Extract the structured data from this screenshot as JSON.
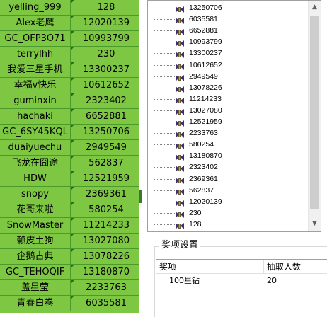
{
  "sheet": {
    "rows": [
      {
        "name": "yelling_999",
        "value": "128"
      },
      {
        "name": "Alex老鹰",
        "value": "12020139"
      },
      {
        "name": "GC_OFP3O71",
        "value": "10993799"
      },
      {
        "name": "terrylhh",
        "value": "230"
      },
      {
        "name": "我爱三星手机",
        "value": "13300237"
      },
      {
        "name": "幸福v快乐",
        "value": "10612652"
      },
      {
        "name": "guminxin",
        "value": "2323402"
      },
      {
        "name": "hachaki",
        "value": "6652881"
      },
      {
        "name": "GC_6SY45KQL",
        "value": "13250706"
      },
      {
        "name": "duaiyuechu",
        "value": "2949549"
      },
      {
        "name": "飞龙在囧途",
        "value": "562837"
      },
      {
        "name": "HDW",
        "value": "12521959"
      },
      {
        "name": "snopy",
        "value": "2369361"
      },
      {
        "name": "花哥来啦",
        "value": "580254"
      },
      {
        "name": "SnowMaster",
        "value": "11214233"
      },
      {
        "name": "赖皮土狗",
        "value": "13027080"
      },
      {
        "name": "企鹅古典",
        "value": "13078226"
      },
      {
        "name": "GC_TEHOQIF",
        "value": "13180870"
      },
      {
        "name": "盖星莹",
        "value": "2233763"
      },
      {
        "name": "青春白卷",
        "value": "6035581"
      }
    ]
  },
  "tree": {
    "items": [
      "13250706",
      "6035581",
      "6652881",
      "10993799",
      "13300237",
      "10612652",
      "2949549",
      "13078226",
      "11214233",
      "13027080",
      "12521959",
      "2233763",
      "580254",
      "13180870",
      "2323402",
      "2369361",
      "562837",
      "12020139",
      "230",
      "128"
    ],
    "scroll_up": "▲",
    "scroll_down": "▼"
  },
  "prize": {
    "group_title": "奖项设置",
    "columns": [
      "奖项",
      "抽取人数"
    ],
    "rows": [
      {
        "prize": "100星钻",
        "count": "20"
      }
    ]
  },
  "colors": {
    "sheet_bg": "#7dc743",
    "grid": "#4c9a2a"
  }
}
